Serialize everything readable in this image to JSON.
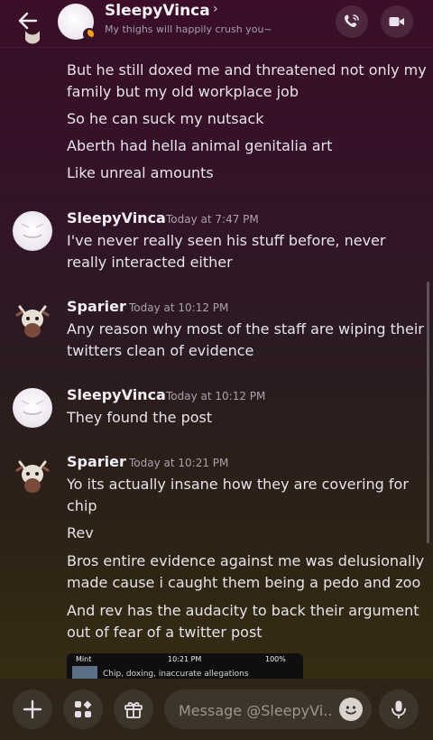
{
  "header": {
    "back_icon": "arrow-left-icon",
    "name": "SleepyVinca",
    "chevron": "›",
    "status": "My thighs will happily crush you~",
    "call_icon": "phone-icon",
    "video_icon": "video-camera-icon"
  },
  "messages_top": [
    "But he still doxed me and threatened not only my family but my old workplace job",
    "So he can suck my nutsack",
    "Aberth had hella animal genitalia art",
    "Like unreal amounts"
  ],
  "groups": [
    {
      "author": "SleepyVinca",
      "time": "Today at 7:47 PM",
      "lines": [
        "I've never really seen his stuff before, never really interacted either"
      ]
    },
    {
      "author": "Sparier",
      "time": "Today at 10:12 PM",
      "lines": [
        "Any reason why most of the staff are wiping their twitters clean of evidence"
      ]
    },
    {
      "author": "SleepyVinca",
      "time": "Today at 10:12 PM",
      "lines": [
        "They found the post"
      ]
    },
    {
      "author": "Sparier",
      "time": "Today at 10:21 PM",
      "lines": [
        "Yo its actually insane how they are covering for chip",
        "Rev",
        "Bros entire evidence against me was delusionally made cause i caught them being a pedo and zoo",
        "And rev has the audacity to back their argument out of fear of a twitter post"
      ]
    }
  ],
  "attachment": {
    "carrier": "Mint",
    "time": "10:21 PM",
    "battery": "100%",
    "line": "Chip, doxing, inaccurate allegations"
  },
  "composer": {
    "placeholder": "Message @SleepyVi...",
    "add_icon": "plus-icon",
    "apps_icon": "apps-icon",
    "gift_icon": "gift-icon",
    "emoji_icon": "emoji-icon",
    "mic_icon": "microphone-icon"
  }
}
